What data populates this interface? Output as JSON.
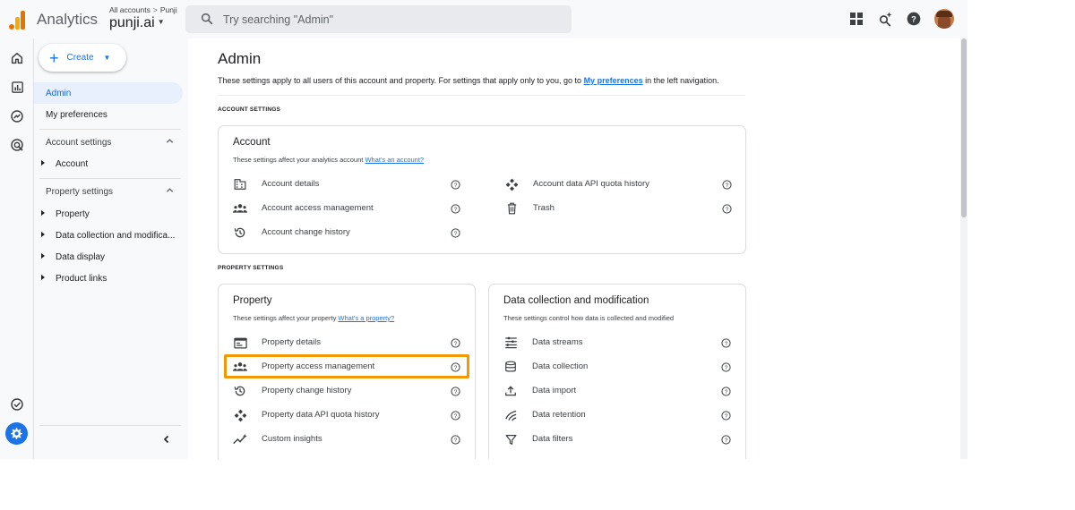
{
  "header": {
    "app_name": "Analytics",
    "breadcrumb_all": "All accounts",
    "breadcrumb_account": "Punji",
    "property_name": "punji.ai",
    "search_placeholder": "Try searching \"Admin\""
  },
  "sidenav": {
    "create_label": "Create",
    "admin_label": "Admin",
    "preferences_label": "My preferences",
    "account_settings_label": "Account settings",
    "account_item": "Account",
    "property_settings_label": "Property settings",
    "property_items": [
      "Property",
      "Data collection and modifica...",
      "Data display",
      "Product links"
    ]
  },
  "main": {
    "title": "Admin",
    "desc_before": "These settings apply to all users of this account and property. For settings that apply only to you, go to ",
    "desc_link": "My preferences",
    "desc_after": " in the left navigation.",
    "account_section_label": "ACCOUNT SETTINGS",
    "property_section_label": "PROPERTY SETTINGS",
    "account_card": {
      "title": "Account",
      "desc": "These settings affect your analytics account ",
      "desc_link": "What's an account?",
      "left_rows": [
        "Account details",
        "Account access management",
        "Account change history"
      ],
      "right_rows": [
        "Account data API quota history",
        "Trash"
      ]
    },
    "property_card": {
      "title": "Property",
      "desc": "These settings affect your property ",
      "desc_link": "What's a property?",
      "rows": [
        "Property details",
        "Property access management",
        "Property change history",
        "Property data API quota history",
        "Custom insights"
      ]
    },
    "data_card": {
      "title": "Data collection and modification",
      "desc": "These settings control how data is collected and modified",
      "rows": [
        "Data streams",
        "Data collection",
        "Data import",
        "Data retention",
        "Data filters"
      ]
    }
  },
  "colors": {
    "accent": "#1a73e8",
    "highlight": "#f29900",
    "active_nav_bg": "#e8f0fe"
  }
}
